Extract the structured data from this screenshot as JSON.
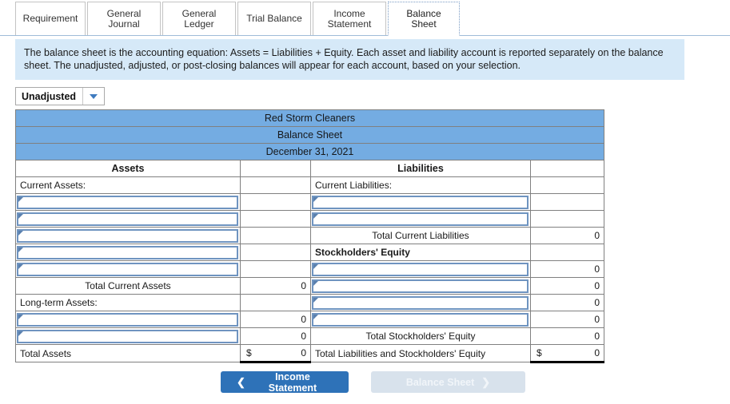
{
  "tabs": [
    {
      "label": "Requirement",
      "active": false
    },
    {
      "label": "General\nJournal",
      "active": false
    },
    {
      "label": "General\nLedger",
      "active": false
    },
    {
      "label": "Trial Balance",
      "active": false
    },
    {
      "label": "Income\nStatement",
      "active": false
    },
    {
      "label": "Balance Sheet",
      "active": true
    }
  ],
  "banner": {
    "text": "The balance sheet is the accounting equation: Assets = Liabilities + Equity. Each asset and liability account is reported separately on the balance sheet. The unadjusted, adjusted, or post-closing balances will appear for each account, based on your selection."
  },
  "selector": {
    "value": "Unadjusted",
    "icon": "chevron-down-icon"
  },
  "sheet": {
    "company": "Red Storm Cleaners",
    "statement": "Balance Sheet",
    "date": "December 31, 2021",
    "col_assets": "Assets",
    "col_liabilities": "Liabilities",
    "current_assets_label": "Current Assets:",
    "current_liabilities_label": "Current Liabilities:",
    "total_current_assets_label": "Total Current Assets",
    "total_current_assets_value": "0",
    "long_term_assets_label": "Long-term Assets:",
    "total_current_liabilities_label": "Total Current Liabilities",
    "total_current_liabilities_value": "0",
    "stockholders_equity_label": "Stockholders' Equity",
    "total_stockholders_equity_label": "Total Stockholders' Equity",
    "total_stockholders_equity_value": "0",
    "total_assets_label": "Total Assets",
    "total_assets_value": "0",
    "total_liab_equity_label": "Total Liabilities and Stockholders' Equity",
    "total_liab_equity_value": "0",
    "dollar_sign": "$",
    "equity_row_values": [
      "0",
      "0",
      "0",
      "0"
    ],
    "asset_input_values": [
      "",
      "",
      "",
      "",
      ""
    ],
    "long_term_input_values": [
      "0",
      "0"
    ]
  },
  "footer": {
    "prev_label": "Income Statement",
    "prev_icon": "chevron-left-icon",
    "next_label": "Balance Sheet",
    "next_icon": "chevron-right-icon"
  },
  "colors": {
    "header_blue": "#74ace2",
    "banner_blue": "#d6e9f8",
    "primary_button": "#2e72b8",
    "field_border": "#6f94c0"
  }
}
